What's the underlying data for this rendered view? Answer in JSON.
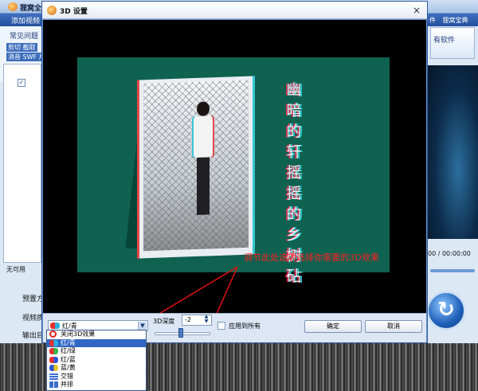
{
  "background_app": {
    "title": "狸窝全",
    "toolbar_add_video": "添加视频",
    "right_menu": [
      "件",
      "狸窝宝典"
    ],
    "faq": "常见问题",
    "edit_line1": "剪切  截取",
    "edit_line2": "消音  SWF  片",
    "right_button": "有软件",
    "no_audio": "无可用",
    "timer": "00 / 00:00:00",
    "preset_label": "预置方",
    "video_quality_label": "视频质",
    "output_label": "输出目",
    "convert_icon": "refresh-icon"
  },
  "dialog": {
    "title": "3D 设置",
    "close_glyph": "×",
    "poem_chars": [
      "幽",
      "暗",
      "的",
      "轩",
      "摇",
      "摇",
      "的",
      "乡",
      "树",
      "砧"
    ],
    "annotation": "调节此处选项选择你需要的3D效果",
    "annotation_color": "#ff2020",
    "controls": {
      "selected_mode": "红/青",
      "depth_label": "3D深度",
      "depth_value": "-2",
      "apply_all_label": "应用到所有",
      "ok_button": "确定",
      "cancel_button": "取消"
    },
    "dropdown_options": [
      {
        "label": "关闭3D效果",
        "icon": "disable-icon"
      },
      {
        "label": "红/青",
        "icon": "red-cyan-glasses-icon",
        "selected": true
      },
      {
        "label": "红/绿",
        "icon": "red-green-glasses-icon"
      },
      {
        "label": "红/蓝",
        "icon": "red-blue-glasses-icon"
      },
      {
        "label": "蓝/黄",
        "icon": "blue-yellow-glasses-icon"
      },
      {
        "label": "交错",
        "icon": "interlaced-icon"
      },
      {
        "label": "并排",
        "icon": "side-by-side-icon"
      }
    ]
  },
  "colors": {
    "dialog_border": "#6b95d0",
    "selection": "#3168c4",
    "video_bg": "#0f6250"
  }
}
